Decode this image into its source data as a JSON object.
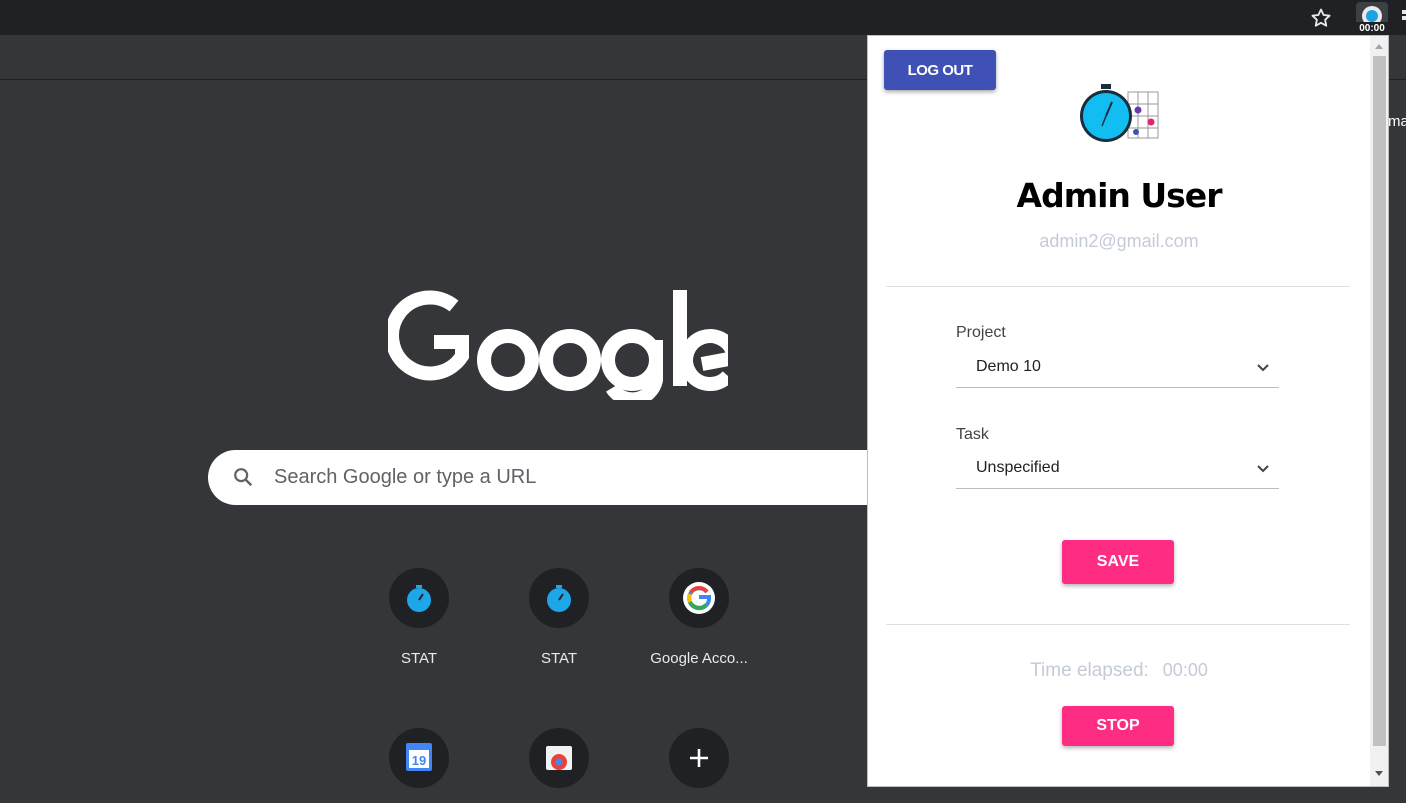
{
  "browser": {
    "extension_badge": "00:00",
    "edge_text": "ma"
  },
  "ntp": {
    "search_placeholder": "Search Google or type a URL",
    "tiles": [
      {
        "label": "STAT",
        "icon": "stopwatch-icon"
      },
      {
        "label": "STAT",
        "icon": "stopwatch-icon"
      },
      {
        "label": "Google Acco...",
        "icon": "google-g-icon"
      },
      {
        "label": "",
        "icon": "calendar-icon",
        "day": "19"
      },
      {
        "label": "",
        "icon": "web-store-icon"
      },
      {
        "label": "",
        "icon": "add-shortcut-icon"
      }
    ]
  },
  "popup": {
    "logout_label": "LOG OUT",
    "user_name": "Admin User",
    "user_email": "admin2@gmail.com",
    "project_label": "Project",
    "project_value": "Demo 10",
    "task_label": "Task",
    "task_value": "Unspecified",
    "save_label": "SAVE",
    "time_label": "Time elapsed:",
    "time_value": "00:00",
    "stop_label": "STOP"
  },
  "colors": {
    "logout_bg": "#3f51b5",
    "pink_accent": "#ff2c84",
    "muted_text": "#c5cad9",
    "chrome_dark": "#202124",
    "ntp_bg": "#35363a"
  }
}
